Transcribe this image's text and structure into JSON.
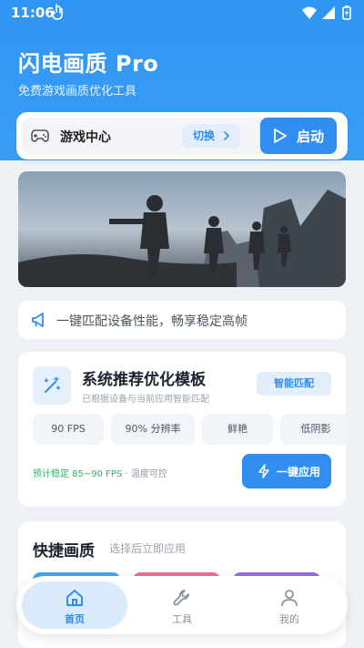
{
  "status_bar": {
    "time": "11:06",
    "icons": [
      "touch-icon",
      "wifi-icon",
      "signal-icon",
      "battery-icon"
    ]
  },
  "header": {
    "title": "闪电画质 Pro",
    "subtitle": "免费游戏画质优化工具"
  },
  "game_bar": {
    "game_icon": "gamepad-icon",
    "game_name": "游戏中心",
    "switch_label": "切换",
    "launch_label": "启动"
  },
  "banner": {
    "alt": "soldiers-battle-banner"
  },
  "notice": {
    "icon": "megaphone-icon",
    "text": "一键匹配设备性能，畅享稳定高帧"
  },
  "template": {
    "icon": "magic-wand-icon",
    "title": "系统推荐优化模板",
    "subtitle": "已根据设备与当前应用智能匹配",
    "smart_match_label": "智能匹配",
    "chips": [
      "90 FPS",
      "90% 分辨率",
      "鲜艳",
      "低阴影"
    ],
    "stat_green": "预计稳定 85~90 FPS",
    "stat_sep": " · ",
    "stat_gray": "温度可控",
    "apply_label": "一键应用"
  },
  "quick": {
    "title": "快捷画质",
    "subtitle": "选择后立即应用"
  },
  "tabbar": {
    "active": "home",
    "items": [
      {
        "key": "home",
        "label": "首页",
        "icon": "home-icon"
      },
      {
        "key": "tools",
        "label": "工具",
        "icon": "wrench-icon"
      },
      {
        "key": "me",
        "label": "我的",
        "icon": "user-icon"
      }
    ]
  },
  "colors": {
    "primary": "#2f8ef0",
    "header": "#3a9ef5",
    "success": "#2bb56a",
    "background": "#eef2f7"
  }
}
